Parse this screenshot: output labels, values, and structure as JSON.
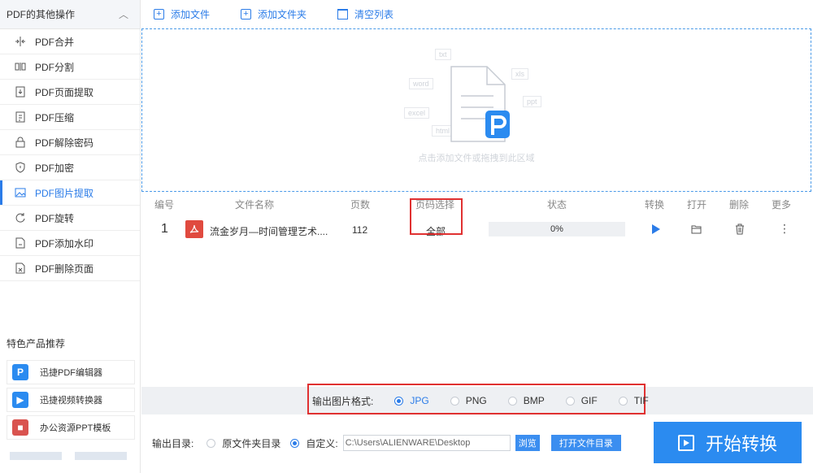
{
  "sidebar": {
    "header": "PDF的其他操作",
    "items": [
      {
        "label": "PDF合并",
        "icon": "merge-icon"
      },
      {
        "label": "PDF分割",
        "icon": "split-icon"
      },
      {
        "label": "PDF页面提取",
        "icon": "page-extract-icon"
      },
      {
        "label": "PDF压缩",
        "icon": "compress-icon"
      },
      {
        "label": "PDF解除密码",
        "icon": "unlock-icon"
      },
      {
        "label": "PDF加密",
        "icon": "shield-icon"
      },
      {
        "label": "PDF图片提取",
        "icon": "image-icon",
        "active": true
      },
      {
        "label": "PDF旋转",
        "icon": "rotate-icon"
      },
      {
        "label": "PDF添加水印",
        "icon": "watermark-icon"
      },
      {
        "label": "PDF删除页面",
        "icon": "delete-page-icon"
      }
    ],
    "featured_title": "特色产品推荐",
    "products": [
      {
        "label": "迅捷PDF编辑器",
        "icon": "pdf-editor-app-icon",
        "color": "#2b8bf0"
      },
      {
        "label": "迅捷视频转换器",
        "icon": "video-converter-app-icon",
        "color": "#2b8bf0"
      },
      {
        "label": "办公资源PPT模板",
        "icon": "ppt-template-app-icon",
        "color": "#d9534f"
      }
    ]
  },
  "toolbar": {
    "add_file": "添加文件",
    "add_folder": "添加文件夹",
    "clear_list": "清空列表"
  },
  "dropzone": {
    "hint": "点击添加文件或拖拽到此区域",
    "tags": [
      "txt",
      "word",
      "xls",
      "ppt",
      "excel",
      "html"
    ]
  },
  "table": {
    "headers": [
      "编号",
      "文件名称",
      "页数",
      "页码选择",
      "状态",
      "转换",
      "打开",
      "删除",
      "更多"
    ],
    "rows": [
      {
        "index": "1",
        "name": "流金岁月—时间管理艺术....",
        "pages": "112",
        "page_select": "全部",
        "progress": "0%"
      }
    ]
  },
  "format": {
    "label": "输出图片格式:",
    "options": [
      "JPG",
      "PNG",
      "BMP",
      "GIF",
      "TIF"
    ],
    "selected": "JPG"
  },
  "output": {
    "label": "输出目录:",
    "option_source": "原文件夹目录",
    "option_custom": "自定义:",
    "selected": "custom",
    "path": "C:\\Users\\ALIENWARE\\Desktop",
    "browse": "浏览",
    "open_folder": "打开文件目录"
  },
  "start_button": "开始转换",
  "colors": {
    "accent": "#2b7ce8",
    "highlight": "#e03131",
    "pdf_red": "#e04a3f"
  }
}
